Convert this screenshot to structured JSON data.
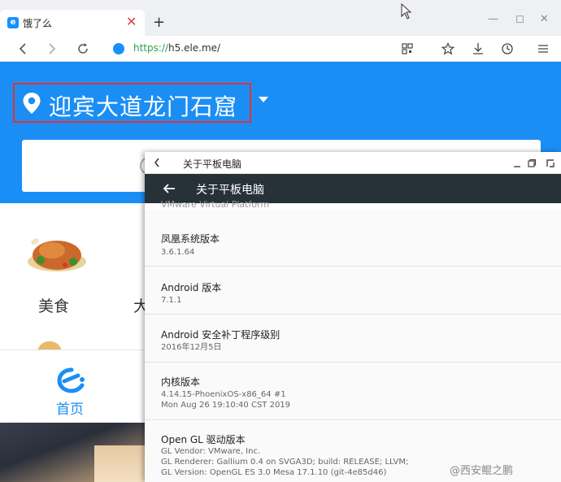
{
  "browser": {
    "tab_title": "饿了么",
    "tab_favicon_text": "e",
    "close_tab_glyph": "✕",
    "new_tab_glyph": "+",
    "minimize_glyph": "—",
    "maximize_glyph": "◻",
    "close_window_glyph": "✕",
    "url_scheme": "https://",
    "url_host": "h5.ele.me/",
    "icons": [
      "back-icon",
      "forward-icon",
      "reload-icon",
      "secure-icon",
      "qr-code-icon",
      "star-icon",
      "download-icon",
      "history-icon",
      "menu-icon"
    ]
  },
  "ele": {
    "location_text": "迎宾大道龙门石窟",
    "categories": [
      {
        "label": "美食"
      },
      {
        "label": "大"
      }
    ],
    "bottom_nav": {
      "home_label": "首页"
    },
    "brand_color": "#1b8ef5"
  },
  "android": {
    "window_title": "关于平板电脑",
    "appbar_title": "关于平板电脑",
    "clipped_text": "VMware Virtual Platform",
    "settings": [
      {
        "title": "凤凰系统版本",
        "values": [
          "3.6.1.64"
        ]
      },
      {
        "title": "Android 版本",
        "values": [
          "7.1.1"
        ]
      },
      {
        "title": "Android 安全补丁程序级别",
        "values": [
          "2016年12月5日"
        ]
      },
      {
        "title": "内核版本",
        "values": [
          "4.14.15-PhoenixOS-x86_64 #1",
          "Mon Aug 26 19:10:40 CST 2019"
        ]
      },
      {
        "title": "Open GL 驱动版本",
        "values": [
          "GL Vendor: VMware, Inc.",
          "GL Renderer: Gallium 0.4 on SVGA3D; build: RELEASE;  LLVM;",
          "GL Version: OpenGL ES 3.0 Mesa 17.1.10 (git-4e85d46)"
        ]
      }
    ],
    "appbar_color": "#263238"
  },
  "watermark": "@西安鲲之鹏"
}
